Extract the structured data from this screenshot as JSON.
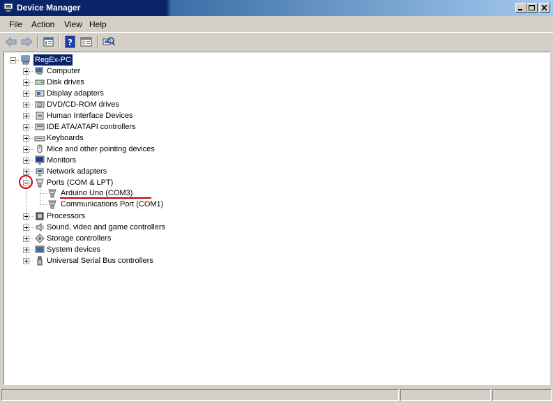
{
  "window": {
    "title": "Device Manager",
    "app_icon": "device-manager-icon",
    "caption_buttons": [
      "minimize-icon",
      "maximize-icon",
      "close-icon"
    ]
  },
  "menu": {
    "items": [
      "File",
      "Action",
      "View",
      "Help"
    ]
  },
  "toolbar": {
    "buttons": [
      "back-arrow-icon",
      "forward-arrow-icon",
      "properties-icon",
      "help-icon",
      "show-hide-console-tree-icon",
      "scan-hardware-changes-icon"
    ]
  },
  "tree": {
    "root": "RegEx-PC",
    "categories": [
      {
        "label": "Computer",
        "icon": "computer-icon"
      },
      {
        "label": "Disk drives",
        "icon": "disk-drive-icon"
      },
      {
        "label": "Display adapters",
        "icon": "display-adapter-icon"
      },
      {
        "label": "DVD/CD-ROM drives",
        "icon": "dvd-drive-icon"
      },
      {
        "label": "Human Interface Devices",
        "icon": "hid-icon"
      },
      {
        "label": "IDE ATA/ATAPI controllers",
        "icon": "ide-controller-icon"
      },
      {
        "label": "Keyboards",
        "icon": "keyboard-icon"
      },
      {
        "label": "Mice and other pointing devices",
        "icon": "mouse-icon"
      },
      {
        "label": "Monitors",
        "icon": "monitor-icon"
      },
      {
        "label": "Network adapters",
        "icon": "network-adapter-icon"
      },
      {
        "label": "Ports (COM & LPT)",
        "icon": "port-icon",
        "expanded": true
      },
      {
        "label": "Processors",
        "icon": "processor-icon"
      },
      {
        "label": "Sound, video and game controllers",
        "icon": "sound-icon"
      },
      {
        "label": "Storage controllers",
        "icon": "storage-controller-icon"
      },
      {
        "label": "System devices",
        "icon": "system-device-icon"
      },
      {
        "label": "Universal Serial Bus controllers",
        "icon": "usb-icon"
      }
    ],
    "ports_children": [
      "Arduino Uno (COM3)",
      "Communications Port (COM1)"
    ]
  },
  "annotations": {
    "circle_color": "#d40000",
    "underline_color": "#c00000"
  },
  "colors": {
    "title_active": "#0a246a",
    "selection": "#0a246a",
    "face": "#d4d0c8"
  }
}
